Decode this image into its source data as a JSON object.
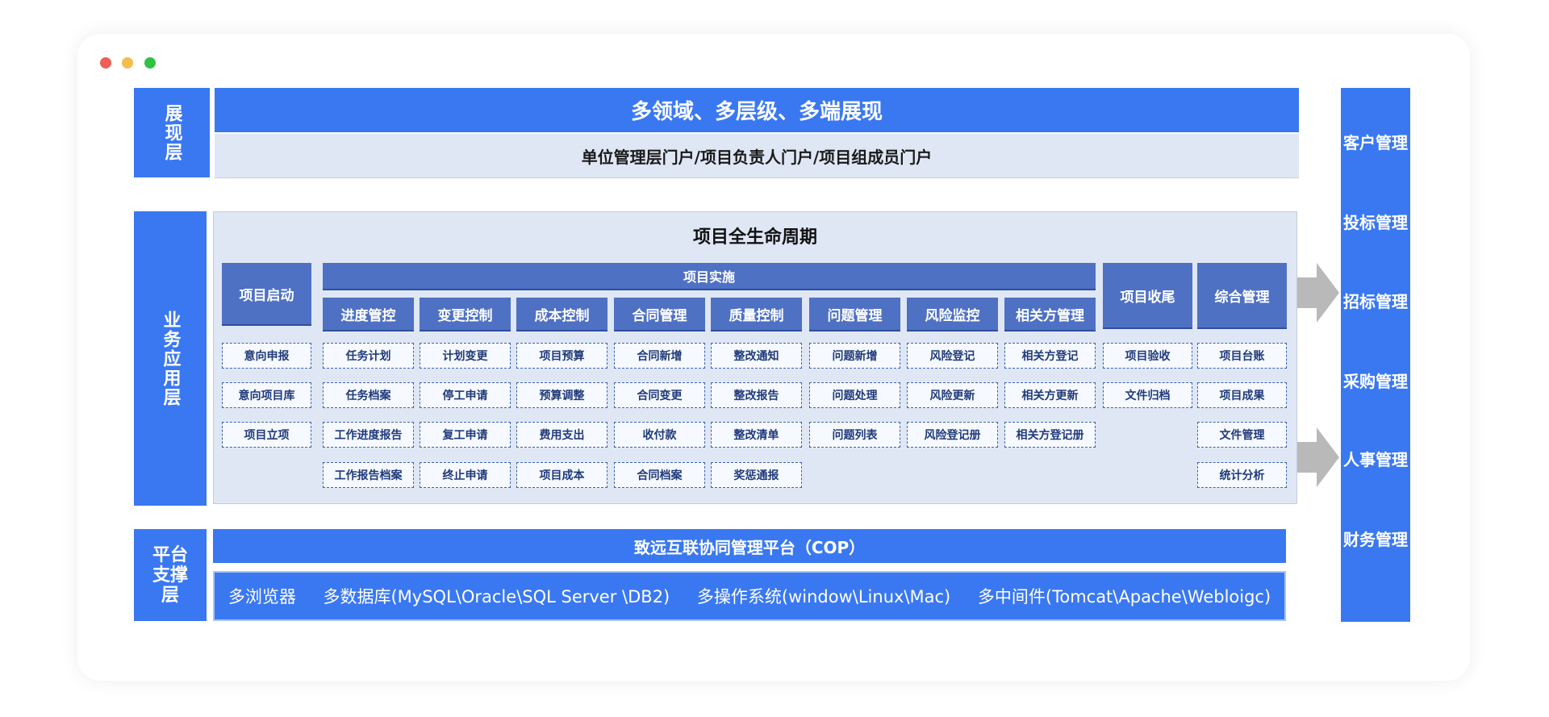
{
  "window_controls": [
    {
      "name": "close",
      "color": "#ee5f57"
    },
    {
      "name": "minimize",
      "color": "#f4bd4f"
    },
    {
      "name": "maximize",
      "color": "#30c244"
    }
  ],
  "presentation": {
    "layer_label": "展现层",
    "title": "多领域、多层级、多端展现",
    "subtitle": "单位管理层门户/项目负责人门户/项目组成员门户"
  },
  "business": {
    "layer_label": "业务应用层",
    "lifecycle_title": "项目全生命周期",
    "start": {
      "label": "项目启动",
      "items": [
        "意向申报",
        "意向项目库",
        "项目立项"
      ]
    },
    "implementation": {
      "label": "项目实施",
      "columns": [
        {
          "label": "进度管控",
          "items": [
            "任务计划",
            "任务档案",
            "工作进度报告",
            "工作报告档案"
          ]
        },
        {
          "label": "变更控制",
          "items": [
            "计划变更",
            "停工申请",
            "复工申请",
            "终止申请"
          ]
        },
        {
          "label": "成本控制",
          "items": [
            "项目预算",
            "预算调整",
            "费用支出",
            "项目成本"
          ]
        },
        {
          "label": "合同管理",
          "items": [
            "合同新增",
            "合同变更",
            "收付款",
            "合同档案"
          ]
        },
        {
          "label": "质量控制",
          "items": [
            "整改通知",
            "整改报告",
            "整改清单",
            "奖惩通报"
          ]
        },
        {
          "label": "问题管理",
          "items": [
            "问题新增",
            "问题处理",
            "问题列表"
          ]
        },
        {
          "label": "风险监控",
          "items": [
            "风险登记",
            "风险更新",
            "风险登记册"
          ]
        },
        {
          "label": "相关方管理",
          "items": [
            "相关方登记",
            "相关方更新",
            "相关方登记册"
          ]
        }
      ]
    },
    "closing": {
      "label": "项目收尾",
      "items": [
        "项目验收",
        "文件归档"
      ]
    },
    "general": {
      "label": "综合管理",
      "items": [
        "项目台账",
        "项目成果",
        "文件管理",
        "统计分析"
      ]
    }
  },
  "platform": {
    "layer_label": "平台支撑层",
    "title": "致远互联协同管理平台（COP）",
    "items": [
      "多浏览器",
      "多数据库(MySQL\\Oracle\\SQL Server \\DB2)",
      "多操作系统(window\\Linux\\Mac)",
      "多中间件(Tomcat\\Apache\\Webloigc)"
    ]
  },
  "right_column": [
    "客户管理",
    "投标管理",
    "招标管理",
    "采购管理",
    "人事管理",
    "财务管理"
  ],
  "colors": {
    "primary": "#3a78f2",
    "header": "#4f71c4",
    "panel": "#dfe7f5"
  }
}
